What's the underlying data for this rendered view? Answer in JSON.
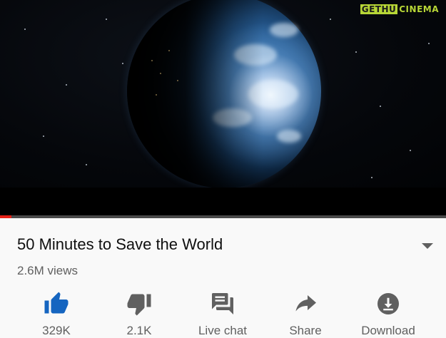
{
  "player": {
    "watermark_part1": "GETHU",
    "watermark_part2": "CINEMA",
    "progress_fraction": 0.026,
    "progress_color": "#e62117"
  },
  "video": {
    "title": "50 Minutes to Save the World",
    "views": "2.6M views"
  },
  "actions": {
    "like": {
      "count": "329K",
      "icon": "thumbs-up-icon",
      "color": "#1565c0"
    },
    "dislike": {
      "count": "2.1K",
      "icon": "thumbs-down-icon"
    },
    "live_chat": {
      "label": "Live chat",
      "icon": "chat-icon"
    },
    "share": {
      "label": "Share",
      "icon": "share-arrow-icon"
    },
    "download": {
      "label": "Download",
      "icon": "download-icon"
    }
  }
}
